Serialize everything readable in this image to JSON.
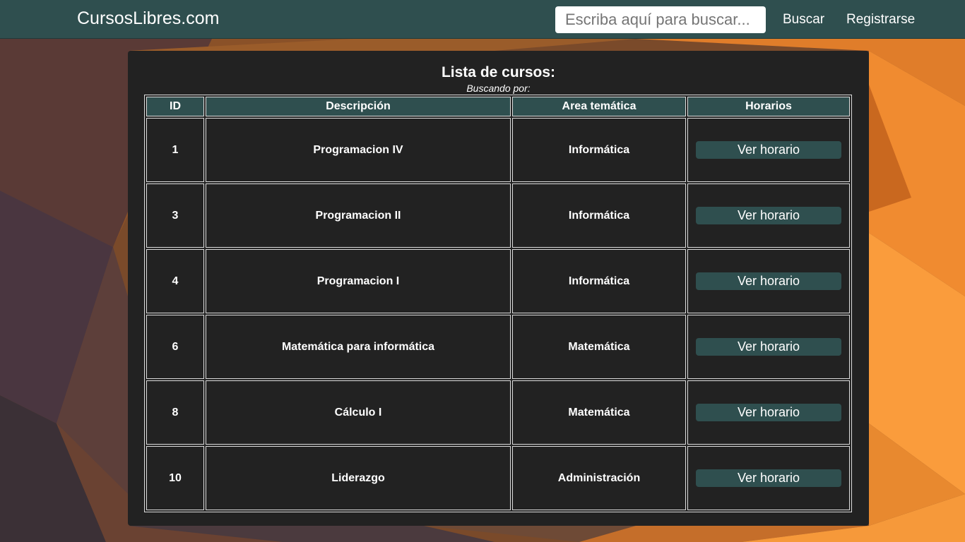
{
  "navbar": {
    "brand": "CursosLibres.com",
    "search_placeholder": "Escriba aquí para buscar...",
    "search_value": "",
    "search_button": "Buscar",
    "register_link": "Registrarse"
  },
  "main": {
    "title": "Lista de cursos:",
    "subtitle": "Buscando por:",
    "columns": [
      "ID",
      "Descripción",
      "Area temática",
      "Horarios"
    ],
    "rows": [
      {
        "id": "1",
        "description": "Programacion IV",
        "area": "Informática",
        "action": "Ver horario"
      },
      {
        "id": "3",
        "description": "Programacion II",
        "area": "Informática",
        "action": "Ver horario"
      },
      {
        "id": "4",
        "description": "Programacion I",
        "area": "Informática",
        "action": "Ver horario"
      },
      {
        "id": "6",
        "description": "Matemática para informática",
        "area": "Matemática",
        "action": "Ver horario"
      },
      {
        "id": "8",
        "description": "Cálculo I",
        "area": "Matemática",
        "action": "Ver horario"
      },
      {
        "id": "10",
        "description": "Liderazgo",
        "area": "Administración",
        "action": "Ver horario"
      }
    ]
  },
  "colors": {
    "navbar": "#2f4f4f",
    "panel": "#222222",
    "button": "#2f4f4f",
    "background_orange": "#f28a2e",
    "background_dark": "#3b3542"
  }
}
